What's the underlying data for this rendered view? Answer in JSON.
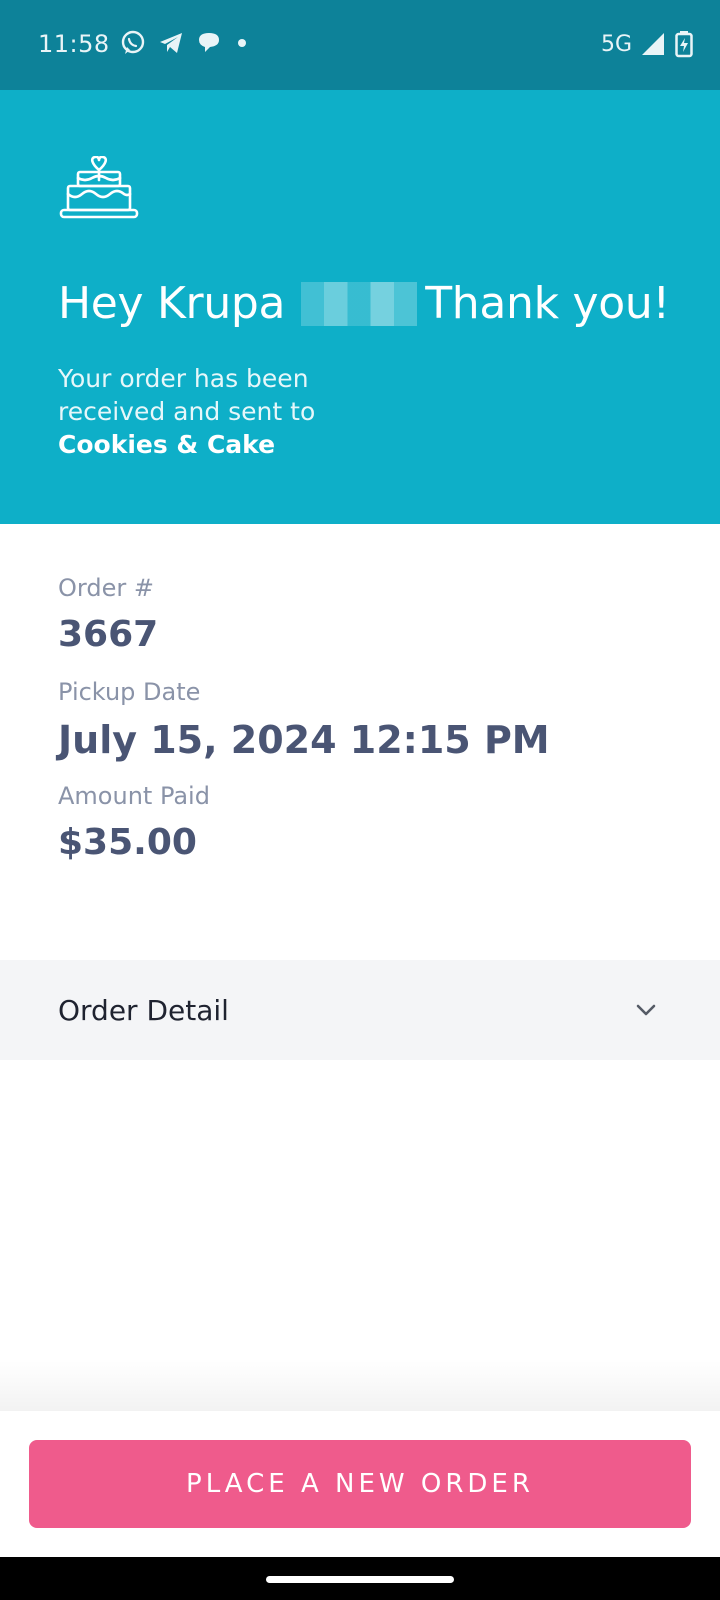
{
  "status_bar": {
    "time": "11:58",
    "network": "5G",
    "icons": [
      "whatsapp-icon",
      "telegram-icon",
      "chat-icon",
      "dot-icon",
      "signal-icon",
      "battery-icon"
    ]
  },
  "hero": {
    "icon": "cake-icon",
    "greeting_prefix": "Hey Krupa",
    "greeting_suffix": "Thank you!",
    "message": "Your order has been received and sent to",
    "store_name": "Cookies & Cake"
  },
  "order": {
    "number_label": "Order #",
    "number": "3667",
    "pickup_label": "Pickup Date",
    "pickup_date": "July 15, 2024 12:15 PM",
    "amount_label": "Amount Paid",
    "amount": "$35.00"
  },
  "order_detail": {
    "label": "Order Detail",
    "icon": "chevron-down-icon"
  },
  "actions": {
    "new_order_label": "PLACE A NEW ORDER"
  },
  "colors": {
    "status_bar": "#0d8299",
    "hero": "#0eafc8",
    "text_value": "#4a5574",
    "text_label": "#8a93a8",
    "button": "#ef5b8c"
  }
}
